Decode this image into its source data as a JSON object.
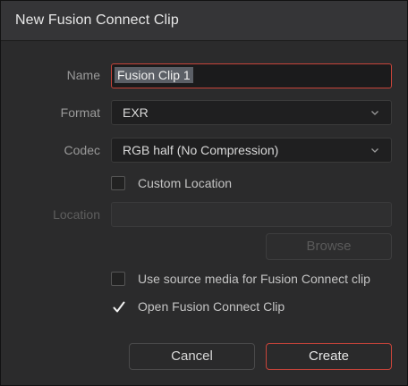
{
  "dialog": {
    "title": "New Fusion Connect Clip"
  },
  "fields": {
    "name": {
      "label": "Name",
      "value": "Fusion Clip 1"
    },
    "format": {
      "label": "Format",
      "value": "EXR"
    },
    "codec": {
      "label": "Codec",
      "value": "RGB half (No Compression)"
    },
    "location": {
      "label": "Location",
      "value": ""
    }
  },
  "options": {
    "custom_location": {
      "label": "Custom Location",
      "checked": false
    },
    "use_source_media": {
      "label": "Use source media for Fusion Connect clip",
      "checked": false
    },
    "open_clip": {
      "label": "Open Fusion Connect Clip",
      "checked": true
    }
  },
  "buttons": {
    "browse": "Browse",
    "cancel": "Cancel",
    "create": "Create"
  },
  "colors": {
    "accent": "#c8443a",
    "background": "#2b2b2c",
    "titlebar": "#353537"
  }
}
